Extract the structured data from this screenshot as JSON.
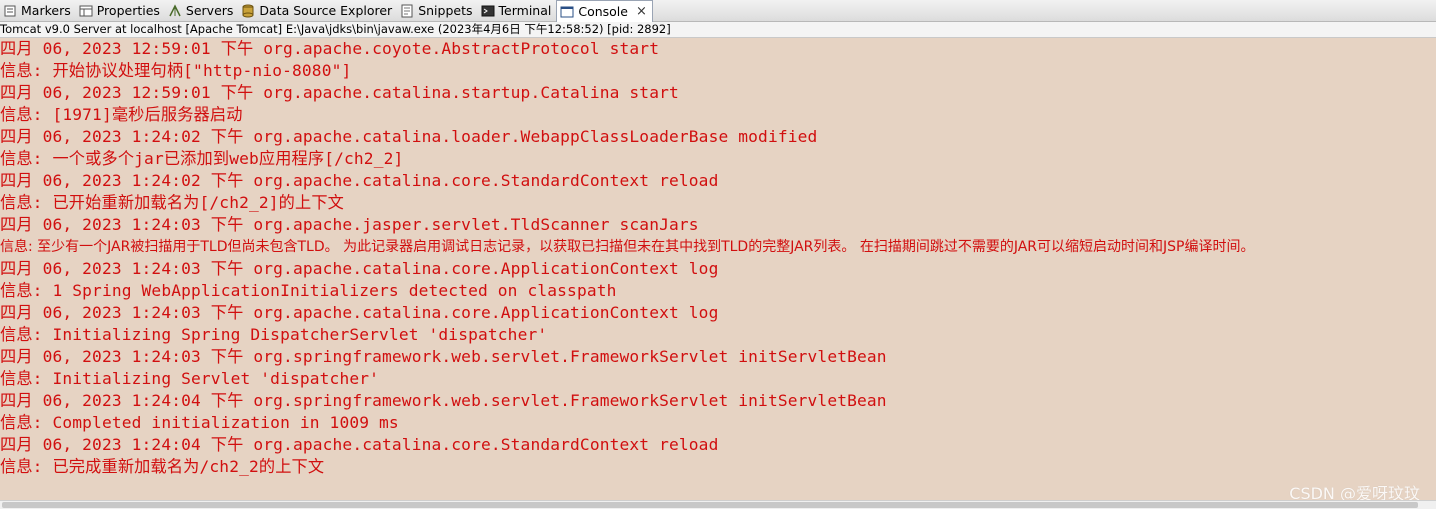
{
  "tabs": [
    {
      "label": "Markers",
      "icon": "markers-icon"
    },
    {
      "label": "Properties",
      "icon": "properties-icon"
    },
    {
      "label": "Servers",
      "icon": "servers-icon"
    },
    {
      "label": "Data Source Explorer",
      "icon": "data-source-icon"
    },
    {
      "label": "Snippets",
      "icon": "snippets-icon"
    },
    {
      "label": "Terminal",
      "icon": "terminal-icon"
    },
    {
      "label": "Console",
      "icon": "console-icon",
      "active": true,
      "close": "×"
    }
  ],
  "process_line": "Tomcat v9.0 Server at localhost [Apache Tomcat] E:\\Java\\jdks\\bin\\javaw.exe  (2023年4月6日 下午12:58:52) [pid: 2892]",
  "console": {
    "text_color": "#d10f0f",
    "lines": [
      "四月 06, 2023 12:59:01 下午 org.apache.coyote.AbstractProtocol start",
      "信息: 开始协议处理句柄[\"http-nio-8080\"]",
      "四月 06, 2023 12:59:01 下午 org.apache.catalina.startup.Catalina start",
      "信息: [1971]毫秒后服务器启动",
      "四月 06, 2023 1:24:02 下午 org.apache.catalina.loader.WebappClassLoaderBase modified",
      "信息: 一个或多个jar已添加到web应用程序[/ch2_2]",
      "四月 06, 2023 1:24:02 下午 org.apache.catalina.core.StandardContext reload",
      "信息: 已开始重新加载名为[/ch2_2]的上下文",
      "四月 06, 2023 1:24:03 下午 org.apache.jasper.servlet.TldScanner scanJars",
      "信息: 至少有一个JAR被扫描用于TLD但尚未包含TLD。 为此记录器启用调试日志记录，以获取已扫描但未在其中找到TLD的完整JAR列表。 在扫描期间跳过不需要的JAR可以缩短启动时间和JSP编译时间。",
      "四月 06, 2023 1:24:03 下午 org.apache.catalina.core.ApplicationContext log",
      "信息: 1 Spring WebApplicationInitializers detected on classpath",
      "四月 06, 2023 1:24:03 下午 org.apache.catalina.core.ApplicationContext log",
      "信息: Initializing Spring DispatcherServlet 'dispatcher'",
      "四月 06, 2023 1:24:03 下午 org.springframework.web.servlet.FrameworkServlet initServletBean",
      "信息: Initializing Servlet 'dispatcher'",
      "四月 06, 2023 1:24:04 下午 org.springframework.web.servlet.FrameworkServlet initServletBean",
      "信息: Completed initialization in 1009 ms",
      "四月 06, 2023 1:24:04 下午 org.apache.catalina.core.StandardContext reload",
      "信息: 已完成重新加载名为/ch2_2的上下文"
    ]
  },
  "watermark": "CSDN @爱呀玟玟"
}
